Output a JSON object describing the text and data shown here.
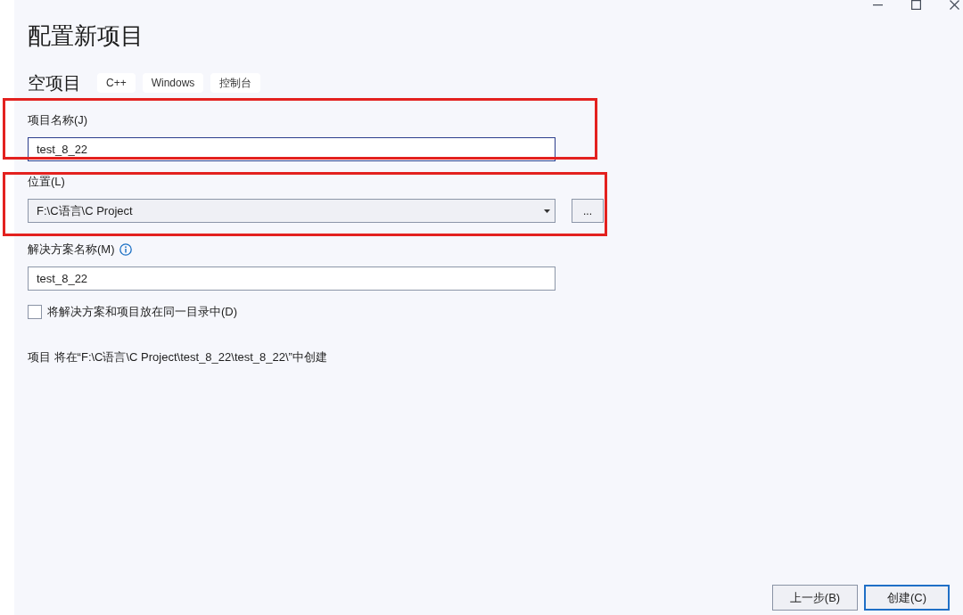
{
  "title": "配置新项目",
  "template": {
    "name": "空项目",
    "tags": [
      "C++",
      "Windows",
      "控制台"
    ]
  },
  "fields": [
    {
      "kind": "text",
      "label": "项目名称(J)",
      "info": false,
      "value": "test_8_22",
      "focused": true,
      "highlighted": true
    },
    {
      "kind": "dropdown",
      "label": "位置(L)",
      "info": false,
      "value": "F:\\C语言\\C Project",
      "browse": "...",
      "focused": false,
      "highlighted": true
    },
    {
      "kind": "text",
      "label": "解决方案名称(M)",
      "info": true,
      "value": "test_8_22",
      "focused": false,
      "highlighted": false
    }
  ],
  "option": {
    "label": "将解决方案和项目放在同一目录中(D)",
    "checked": false
  },
  "summary": "项目 将在“F:\\C语言\\C Project\\test_8_22\\test_8_22\\”中创建",
  "buttons": [
    {
      "label": "上一步(B)",
      "default": false
    },
    {
      "label": "创建(C)",
      "default": true
    }
  ]
}
